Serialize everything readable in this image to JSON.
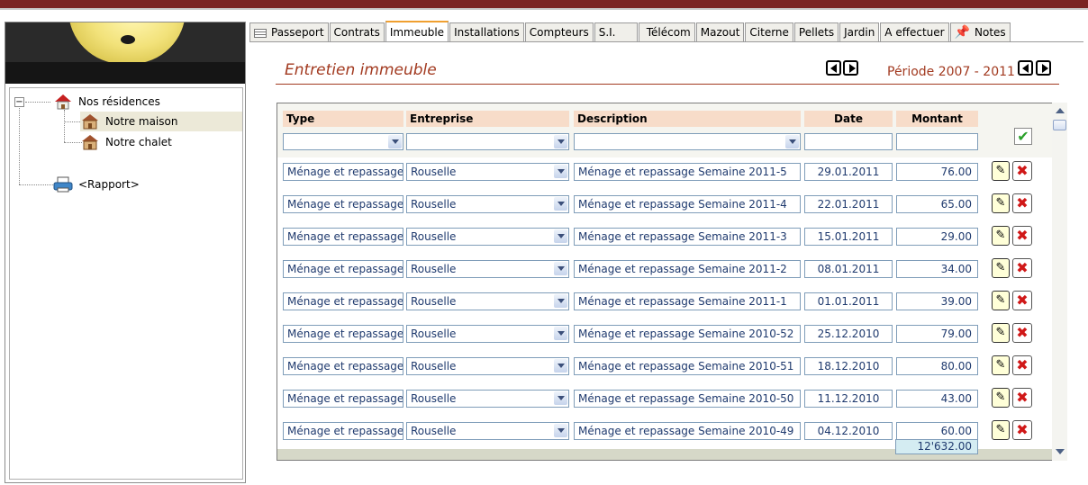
{
  "tree": {
    "root": "Nos résidences",
    "children": [
      "Notre maison",
      "Notre chalet"
    ],
    "report": "<Rapport>"
  },
  "tabs": [
    "Passeport",
    "Contrats",
    "Immeuble",
    "Installations",
    "Compteurs",
    "S.I.",
    "Télécom",
    "Mazout",
    "Citerne",
    "Pellets",
    "Jardin",
    "A effectuer",
    "Notes"
  ],
  "active_tab": "Immeuble",
  "section": {
    "title": "Entretien immeuble",
    "period": "Période 2007 - 2011"
  },
  "grid": {
    "headers": {
      "type": "Type",
      "entreprise": "Entreprise",
      "description": "Description",
      "date": "Date",
      "montant": "Montant"
    },
    "rows": [
      {
        "type": "Ménage et repassage",
        "entreprise": "Rouselle",
        "description": "Ménage et repassage Semaine 2011-5",
        "date": "29.01.2011",
        "montant": "76.00"
      },
      {
        "type": "Ménage et repassage",
        "entreprise": "Rouselle",
        "description": "Ménage et repassage Semaine 2011-4",
        "date": "22.01.2011",
        "montant": "65.00"
      },
      {
        "type": "Ménage et repassage",
        "entreprise": "Rouselle",
        "description": "Ménage et repassage Semaine 2011-3",
        "date": "15.01.2011",
        "montant": "29.00"
      },
      {
        "type": "Ménage et repassage",
        "entreprise": "Rouselle",
        "description": "Ménage et repassage Semaine 2011-2",
        "date": "08.01.2011",
        "montant": "34.00"
      },
      {
        "type": "Ménage et repassage",
        "entreprise": "Rouselle",
        "description": "Ménage et repassage Semaine 2011-1",
        "date": "01.01.2011",
        "montant": "39.00"
      },
      {
        "type": "Ménage et repassage",
        "entreprise": "Rouselle",
        "description": "Ménage et repassage Semaine 2010-52",
        "date": "25.12.2010",
        "montant": "79.00"
      },
      {
        "type": "Ménage et repassage",
        "entreprise": "Rouselle",
        "description": "Ménage et repassage Semaine 2010-51",
        "date": "18.12.2010",
        "montant": "80.00"
      },
      {
        "type": "Ménage et repassage",
        "entreprise": "Rouselle",
        "description": "Ménage et repassage Semaine 2010-50",
        "date": "11.12.2010",
        "montant": "43.00"
      },
      {
        "type": "Ménage et repassage",
        "entreprise": "Rouselle",
        "description": "Ménage et repassage Semaine 2010-49",
        "date": "04.12.2010",
        "montant": "60.00"
      }
    ],
    "total": "12'632.00"
  },
  "icons": {
    "edit": "edit-icon",
    "delete": "delete-icon",
    "confirm": "checkmark-icon",
    "house": "house-icon",
    "printer": "printer-icon",
    "notes": "pushpin-icon"
  },
  "colors": {
    "accent": "#a23a20",
    "topbar": "#7a2322",
    "header_cell": "#f7dcc9",
    "value_text": "#1f3a6e"
  }
}
